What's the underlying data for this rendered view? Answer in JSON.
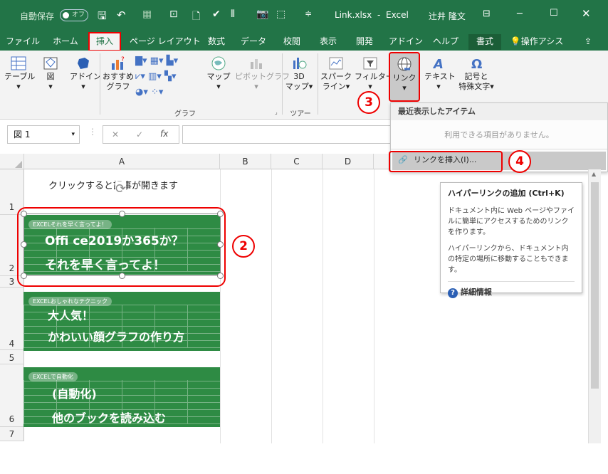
{
  "titlebar": {
    "autosave": "自動保存",
    "autosave_state": "オフ",
    "filename": "Link.xlsx",
    "separator": "-",
    "app": "Excel",
    "user": "辻井 隆文"
  },
  "tabs": [
    "ファイル",
    "ホーム",
    "挿入",
    "ページ レイアウト",
    "数式",
    "データ",
    "校閲",
    "表示",
    "開発",
    "アドイン",
    "ヘルプ",
    "書式"
  ],
  "tell_me": "操作アシス",
  "ribbon": {
    "table": "テーブル",
    "figure": "図",
    "addin": "アドイン",
    "recommended_chart_1": "おすすめ",
    "recommended_chart_2": "グラフ",
    "map": "マップ",
    "pivotchart": "ピボットグラフ",
    "map3d_1": "3D",
    "map3d_2": "マップ",
    "sparkline_1": "スパーク",
    "sparkline_2": "ライン",
    "filter": "フィルター",
    "link": "リンク",
    "text": "テキスト",
    "symbol_1": "記号と",
    "symbol_2": "特殊文字",
    "group_chart": "グラフ",
    "group_tour": "ツアー"
  },
  "dropdown": {
    "header": "最近表示したアイテム",
    "empty": "利用できる項目がありません。",
    "insert_link": "リンクを挿入(I)..."
  },
  "tooltip": {
    "title": "ハイパーリンクの追加 (Ctrl+K)",
    "body1": "ドキュメント内に Web ページやファイルに簡単にアクセスするためのリンクを作ります。",
    "body2": "ハイパーリンクから、ドキュメント内の特定の場所に移動することもできます。",
    "more": "詳細情報"
  },
  "formula": {
    "namebox": "図 1",
    "cancel": "✕",
    "enter": "✓",
    "fx": "fx"
  },
  "columns": [
    "A",
    "B",
    "C",
    "D"
  ],
  "rows": [
    "1",
    "2",
    "3",
    "4",
    "5",
    "6",
    "7"
  ],
  "cell_a1": "クリックすると記事が開きます",
  "thumbs": [
    {
      "tag": "EXCELそれを早く言ってよ！",
      "line1": "Offi ce2019か365か？",
      "line2": "それを早く言ってよ！"
    },
    {
      "tag": "EXCELおしゃれなテクニック",
      "line1": "大人気！",
      "line2": "かわいい顔グラフの作り方"
    },
    {
      "tag": "EXCELで自動化",
      "line1": "(自動化)",
      "line2": "他のブックを読み込む"
    }
  ],
  "callouts": [
    "2",
    "3",
    "4"
  ],
  "colors": {
    "excel_green": "#227447",
    "callout_red": "#e00000",
    "thumb_green": "#2e8b44"
  }
}
